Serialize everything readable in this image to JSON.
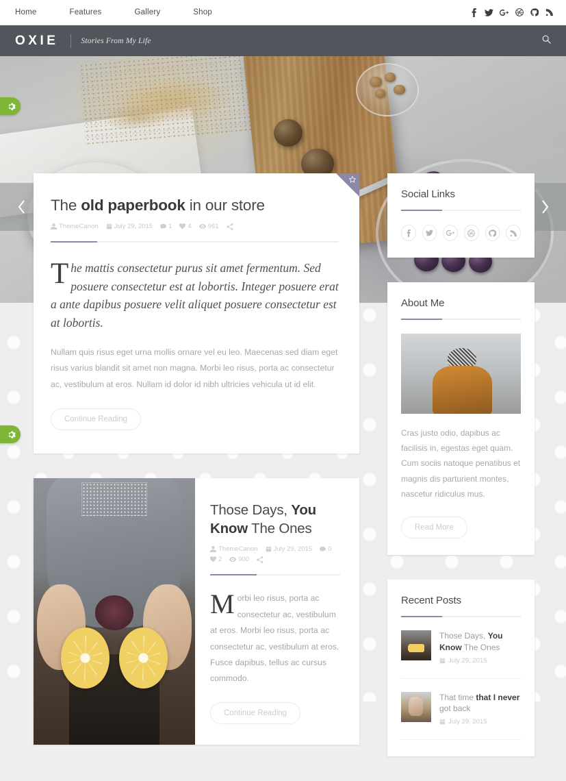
{
  "topnav": {
    "links": [
      {
        "label": "Home"
      },
      {
        "label": "Features"
      },
      {
        "label": "Gallery"
      },
      {
        "label": "Shop"
      }
    ],
    "social": [
      {
        "name": "facebook-icon"
      },
      {
        "name": "twitter-icon"
      },
      {
        "name": "google-plus-icon"
      },
      {
        "name": "dribbble-icon"
      },
      {
        "name": "github-icon"
      },
      {
        "name": "rss-icon"
      }
    ]
  },
  "header": {
    "logo": "OXIE",
    "tagline": "Stories From My Life",
    "search_icon": "search-icon"
  },
  "hero": {
    "prev_label": "Previous slide",
    "next_label": "Next slide"
  },
  "side_tabs": [
    {
      "name": "settings-tab-top",
      "icon": "gear-icon",
      "color": "#7fb637"
    },
    {
      "name": "settings-tab-bottom",
      "icon": "gear-icon",
      "color": "#7fb637"
    }
  ],
  "posts": [
    {
      "title_pre": "The ",
      "title_bold": "old paperbook",
      "title_post": " in our store",
      "author": "ThemeCanon",
      "date": "July 29, 2015",
      "comments": "1",
      "likes": "4",
      "views": "961",
      "featured_badge": "star-icon",
      "lead": "The mattis consectetur purus sit amet fermentum. Sed posuere consectetur est at lobortis. Integer posuere erat a ante dapibus posuere velit aliquet posuere consectetur est at lobortis.",
      "body": "Nullam quis risus eget urna mollis ornare vel eu leo. Maecenas sed diam eget risus varius blandit sit amet non magna. Morbi leo risus, porta ac consectetur ac, vestibulum at eros. Nullam id dolor id nibh ultricies vehicula ut id elit.",
      "cta": "Continue Reading"
    },
    {
      "title_pre": "Those Days, ",
      "title_bold": "You Know",
      "title_post": " The Ones",
      "author": "ThemeCanon",
      "date": "July 29, 2015",
      "comments": "0",
      "likes": "2",
      "views": "900",
      "body": "Morbi leo risus, porta ac consectetur ac, vestibulum at eros. Morbi leo risus, porta ac consectetur ac, vestibulum at eros. Fusce dapibus, tellus ac cursus commodo.",
      "cta": "Continue Reading"
    }
  ],
  "sidebar": {
    "social_widget": {
      "title": "Social Links",
      "icons": [
        {
          "name": "facebook-icon"
        },
        {
          "name": "twitter-icon"
        },
        {
          "name": "google-plus-icon"
        },
        {
          "name": "dribbble-icon"
        },
        {
          "name": "github-icon"
        },
        {
          "name": "rss-icon"
        }
      ]
    },
    "about_widget": {
      "title": "About Me",
      "text": "Cras justo odio, dapibus ac facilisis in, egestas eget quam. Cum sociis natoque penatibus et magnis dis parturient montes, nascetur ridiculus mus.",
      "cta": "Read More"
    },
    "recent_widget": {
      "title": "Recent Posts",
      "items": [
        {
          "title_pre": "Those Days, ",
          "title_bold": "You Know",
          "title_post": " The Ones",
          "date": "July 29, 2015"
        },
        {
          "title_pre": "That time ",
          "title_bold": "that I never",
          "title_post": " got back",
          "date": "July 29, 2015"
        }
      ]
    }
  },
  "colors": {
    "accent": "#8d88a8",
    "header_bar": "#52565c",
    "tab_green": "#7fb637"
  }
}
